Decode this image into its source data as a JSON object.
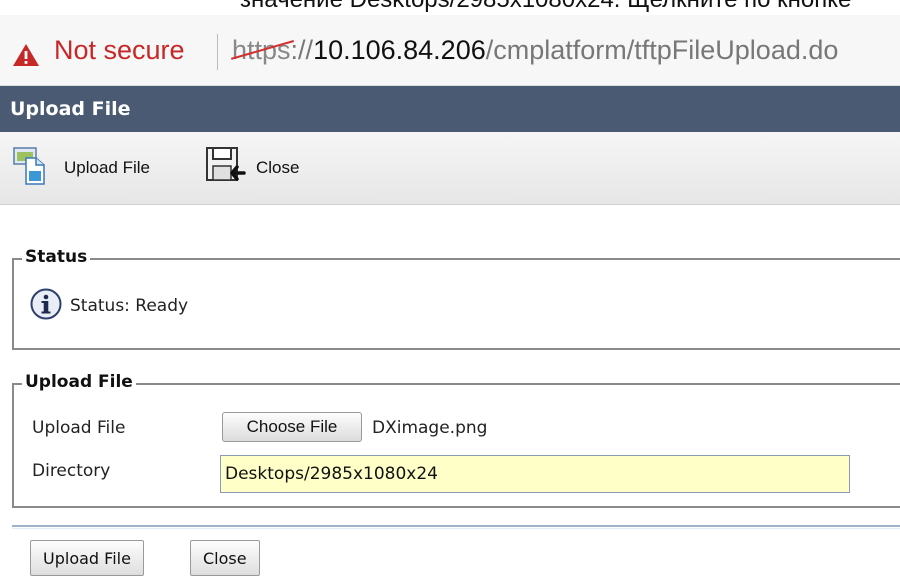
{
  "browser": {
    "top_caption": "значение Desktops/2985x1080x24. Щелкните по кнопке",
    "security_text": "Not secure",
    "url_scheme": "https",
    "url_sep": "://",
    "url_host": "10.106.84.206",
    "url_path": "/cmplatform/tftpFileUpload.do"
  },
  "window": {
    "title": "Upload File"
  },
  "toolbar": {
    "upload_label": "Upload File",
    "close_label": "Close"
  },
  "status_section": {
    "legend": "Status",
    "text": "Status: Ready"
  },
  "upload_section": {
    "legend": "Upload File",
    "file_label": "Upload File",
    "choose_button": "Choose File",
    "file_name": "DXimage.png",
    "directory_label": "Directory",
    "directory_value": "Desktops/2985x1080x24"
  },
  "footer": {
    "upload_button": "Upload File",
    "close_button": "Close"
  },
  "icons": {
    "warning": "warning-triangle-icon",
    "upload": "upload-file-icon",
    "close": "close-window-icon",
    "info": "info-icon"
  },
  "colors": {
    "title_bar": "#4a5a72",
    "warning": "#c62828",
    "input_highlight": "#ffffc8"
  }
}
